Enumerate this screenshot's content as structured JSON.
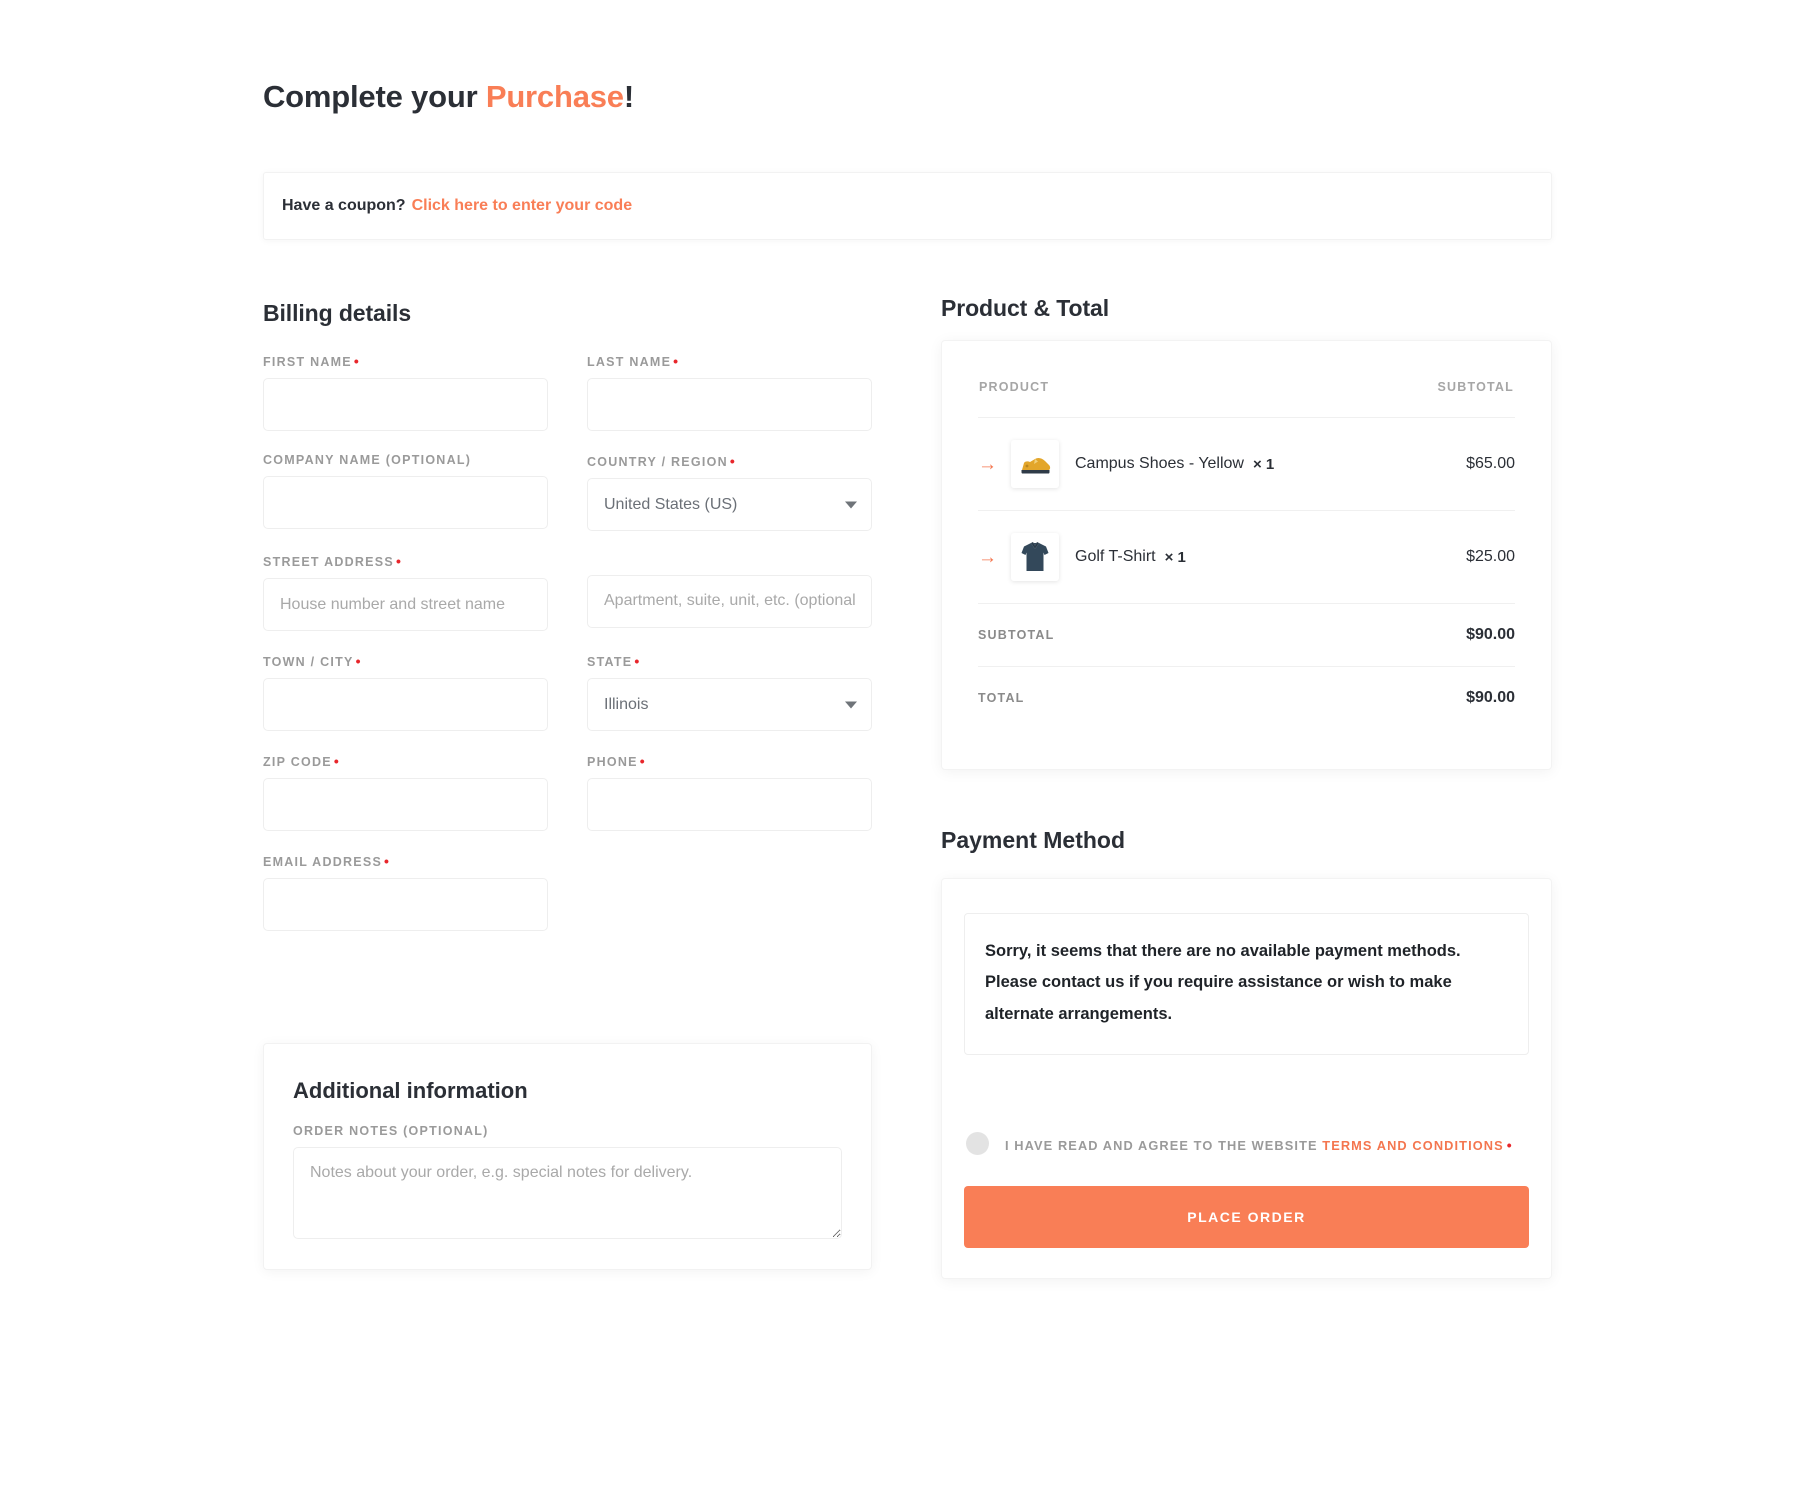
{
  "heading": {
    "prefix": "Complete your ",
    "accent": "Purchase",
    "suffix": "!"
  },
  "coupon": {
    "question": "Have a coupon?",
    "link": "Click here to enter your code"
  },
  "billing": {
    "title": "Billing details",
    "fields": {
      "first_name": {
        "label": "First name",
        "value": "",
        "placeholder": ""
      },
      "last_name": {
        "label": "Last name",
        "value": "",
        "placeholder": ""
      },
      "company_name": {
        "label": "Company name (optional)",
        "value": "",
        "placeholder": ""
      },
      "country": {
        "label": "Country / Region",
        "value": "United States (US)"
      },
      "street_address": {
        "label": "Street address",
        "placeholder": "House number and street name",
        "value": ""
      },
      "address_line2": {
        "label": "",
        "placeholder": "Apartment, suite, unit, etc. (optional)",
        "value": ""
      },
      "town_city": {
        "label": "Town / City",
        "value": "",
        "placeholder": ""
      },
      "state": {
        "label": "State",
        "value": "Illinois"
      },
      "zip_code": {
        "label": "ZIP Code",
        "value": "",
        "placeholder": ""
      },
      "phone": {
        "label": "Phone",
        "value": "",
        "placeholder": ""
      },
      "email": {
        "label": "Email address",
        "value": "",
        "placeholder": ""
      }
    }
  },
  "additional": {
    "title": "Additional information",
    "notes_label": "Order notes (optional)",
    "notes_placeholder": "Notes about your order, e.g. special notes for delivery.",
    "notes_value": ""
  },
  "summary": {
    "title": "Product & Total",
    "columns": {
      "product": "Product",
      "subtotal": "Subtotal"
    },
    "items": [
      {
        "name": "Campus Shoes - Yellow",
        "qty": "× 1",
        "price": "$65.00",
        "thumb": "shoe-thumbnail"
      },
      {
        "name": "Golf T-Shirt",
        "qty": "× 1",
        "price": "$25.00",
        "thumb": "tshirt-thumbnail"
      }
    ],
    "subtotal_label": "Subtotal",
    "subtotal_value": "$90.00",
    "total_label": "Total",
    "total_value": "$90.00"
  },
  "payment": {
    "title": "Payment Method",
    "notice": "Sorry, it seems that there are no available payment methods. Please contact us if you require assistance or wish to make alternate arrangements.",
    "terms_prefix": "I have read and agree to the website ",
    "terms_link": "terms and conditions",
    "place_order_label": "Place order"
  },
  "colors": {
    "accent": "#f97e56",
    "arrow": "#f4764f",
    "required": "#e8262b",
    "text": "#2b2f36",
    "muted": "#9a9a9a"
  }
}
